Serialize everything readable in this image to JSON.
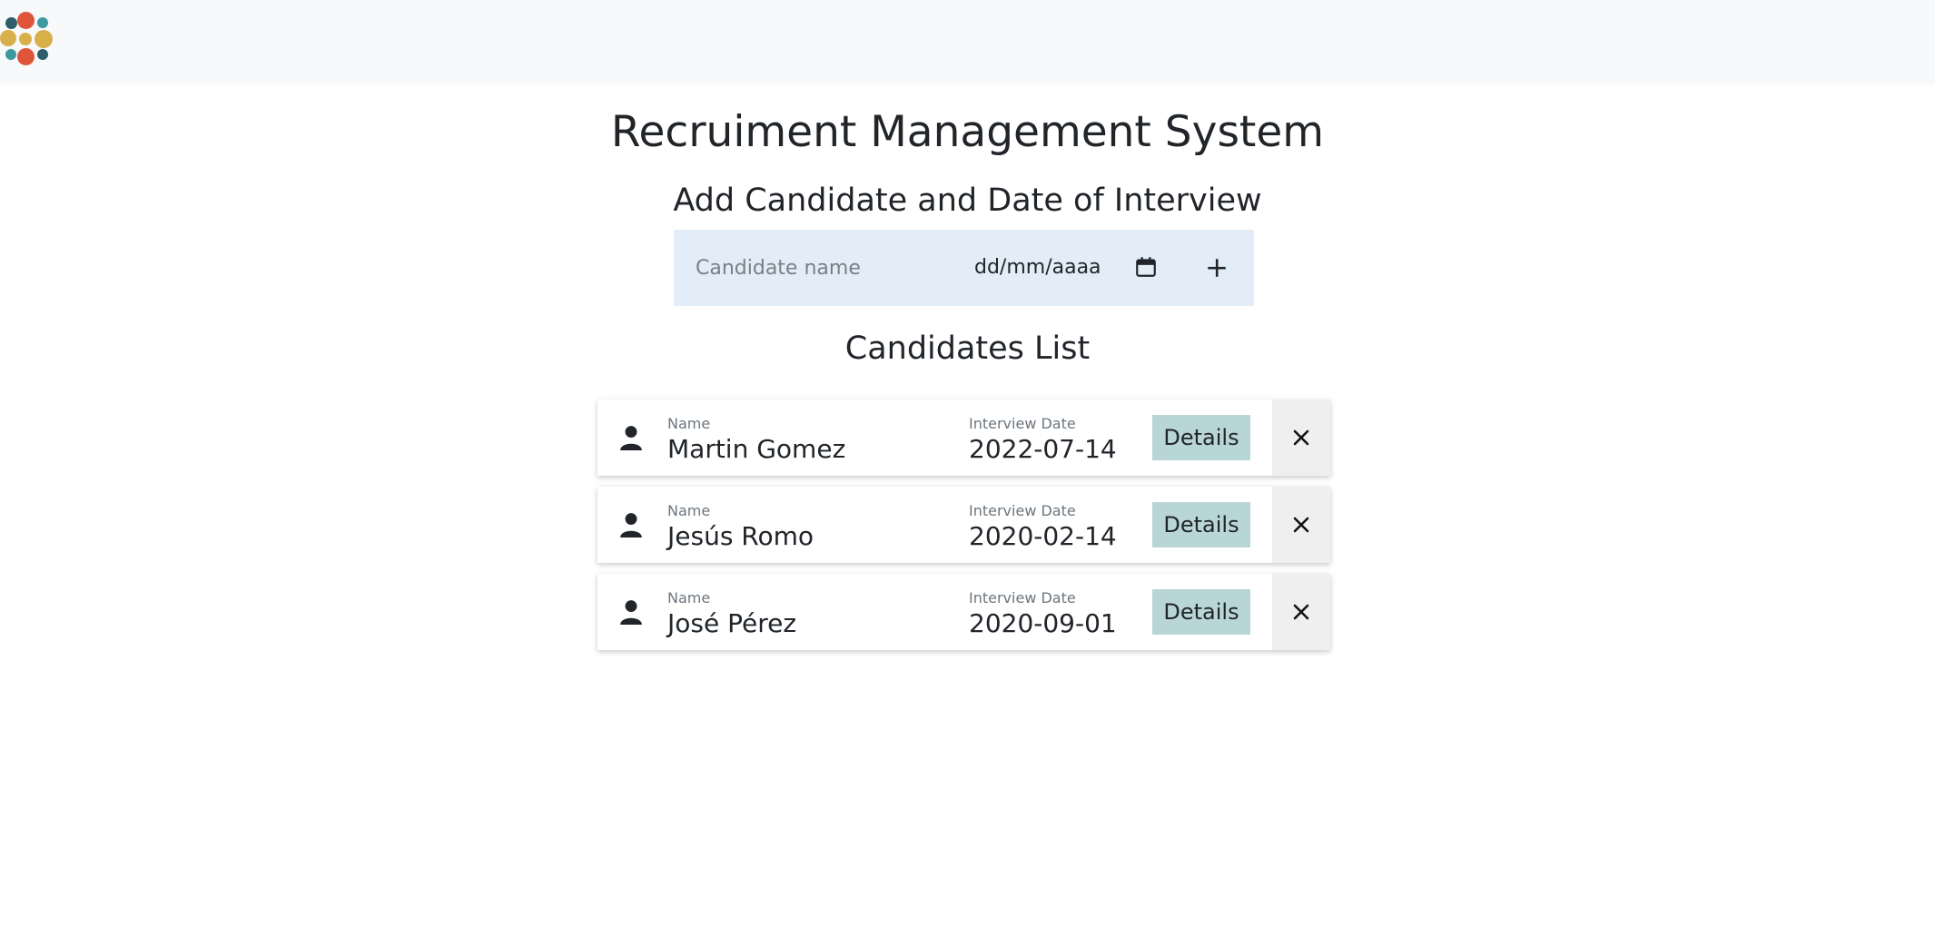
{
  "header": {
    "logo": "dots-logo"
  },
  "page": {
    "title": "Recruiment Management System",
    "add_section_title": "Add Candidate and Date of Interview",
    "list_title": "Candidates List"
  },
  "form": {
    "name_placeholder": "Candidate name",
    "date_placeholder": "dd/mm/aaaa",
    "calendar_icon": "calendar-icon",
    "add_icon": "plus-icon"
  },
  "candidates": [
    {
      "name_label": "Name",
      "name": "Martin Gomez",
      "date_label": "Interview Date",
      "date": "2022-07-14",
      "details_label": "Details"
    },
    {
      "name_label": "Name",
      "name": "Jesús Romo",
      "date_label": "Interview Date",
      "date": "2020-02-14",
      "details_label": "Details"
    },
    {
      "name_label": "Name",
      "name": "José Pérez",
      "date_label": "Interview Date",
      "date": "2020-09-01",
      "details_label": "Details"
    }
  ],
  "colors": {
    "topbar": "#f8f9fa",
    "form_bg": "#e2edf7",
    "details_bg": "#b9d6d6",
    "delete_bg": "#efefef",
    "logo_red": "#e0553a",
    "logo_yellow": "#d8b04a",
    "logo_teal": "#3d9aa0",
    "logo_dark": "#2f5d6b"
  }
}
